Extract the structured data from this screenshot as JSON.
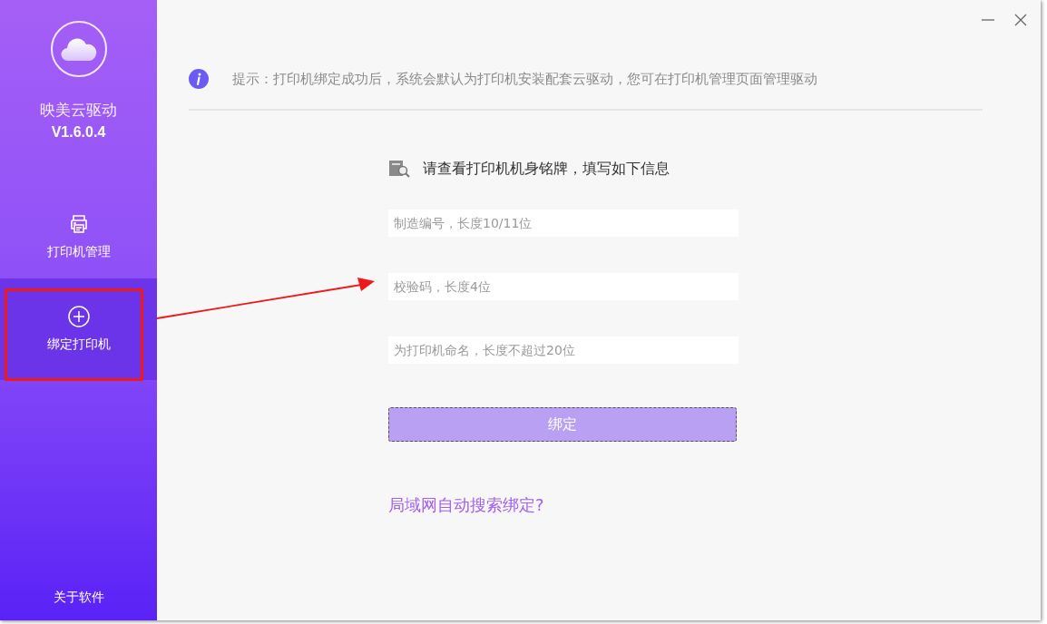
{
  "app": {
    "name": "映美云驱动",
    "version": "V1.6.0.4"
  },
  "nav": [
    {
      "label": "打印机管理",
      "kind": "printer",
      "selected": false
    },
    {
      "label": "绑定打印机",
      "kind": "add",
      "selected": true
    }
  ],
  "footer_link": "关于软件",
  "notice": "提示：打印机绑定成功后，系统会默认为打印机安装配套云驱动，您可在打印机管理页面管理驱动",
  "form": {
    "heading": "请查看打印机机身铭牌，填写如下信息",
    "fields": [
      {
        "placeholder": "制造编号，长度10/11位"
      },
      {
        "placeholder": "校验码，长度4位"
      },
      {
        "placeholder": "为打印机命名，长度不超过20位"
      }
    ],
    "submit": {
      "label": "绑定",
      "disabled": true
    },
    "link": "局域网自动搜索绑定?"
  }
}
